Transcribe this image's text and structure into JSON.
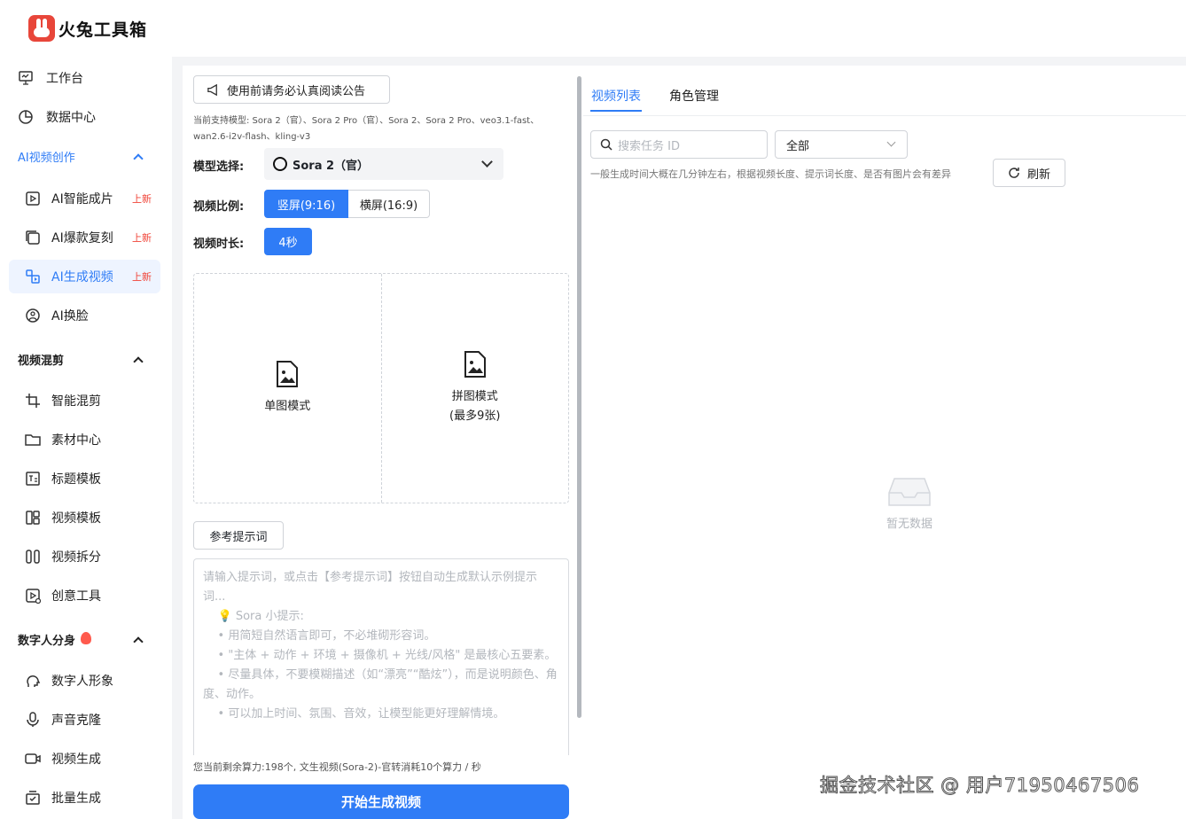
{
  "app": {
    "brand": "火兔工具箱"
  },
  "sidebar": {
    "top_items": [
      {
        "label": "工作台",
        "icon": "monitor-icon"
      },
      {
        "label": "数据中心",
        "icon": "pie-chart-icon"
      }
    ],
    "sections": [
      {
        "label": "AI视频创作",
        "items": [
          {
            "label": "AI智能成片",
            "badge": "上新",
            "icon": "ai-video-icon"
          },
          {
            "label": "AI爆款复刻",
            "badge": "上新",
            "icon": "copy-video-icon"
          },
          {
            "label": "AI生成视频",
            "badge": "上新",
            "icon": "generate-video-icon",
            "active": true
          },
          {
            "label": "AI换脸",
            "icon": "face-swap-icon"
          }
        ]
      },
      {
        "label": "视频混剪",
        "items": [
          {
            "label": "智能混剪",
            "icon": "crop-icon"
          },
          {
            "label": "素材中心",
            "icon": "folder-icon"
          },
          {
            "label": "标题模板",
            "icon": "title-template-icon"
          },
          {
            "label": "视频模板",
            "icon": "layout-template-icon"
          },
          {
            "label": "视频拆分",
            "icon": "split-icon"
          },
          {
            "label": "创意工具",
            "icon": "creative-tool-icon"
          }
        ]
      },
      {
        "label": "数字人分身",
        "items": [
          {
            "label": "数字人形象",
            "icon": "digital-human-icon"
          },
          {
            "label": "声音克隆",
            "icon": "microphone-icon"
          },
          {
            "label": "视频生成",
            "icon": "camera-icon"
          },
          {
            "label": "批量生成",
            "icon": "batch-icon"
          }
        ]
      }
    ]
  },
  "main": {
    "notice_button": "使用前请务必认真阅读公告",
    "supported_models": "当前支持模型: Sora 2（官）、Sora 2 Pro（官）、Sora 2、Sora 2 Pro、veo3.1-fast、wan2.6-i2v-flash、kling-v3",
    "model_label": "模型选择:",
    "model_value": "Sora 2（官）",
    "ratio_label": "视频比例:",
    "ratio_options": [
      "竖屏(9:16)",
      "横屏(16:9)"
    ],
    "duration_label": "视频时长:",
    "duration_value": "4秒",
    "upload_single": "单图模式",
    "upload_collage": "拼图模式",
    "upload_collage_sub": "(最多9张)",
    "ref_prompt_button": "参考提示词",
    "prompt_placeholder": "请输入提示词，或点击【参考提示词】按钮自动生成默认示例提示词...\n    💡 Sora 小提示:\n    • 用简短自然语言即可，不必堆砌形容词。\n    • \"主体 + 动作 + 环境 + 摄像机 + 光线/风格\" 是最核心五要素。\n    • 尽量具体，不要模糊描述（如“漂亮”“酷炫”），而是说明颜色、角度、动作。\n    • 可以加上时间、氛围、音效，让模型能更好理解情境。",
    "quota_text": "您当前剩余算力:198个, 文生视频(Sora-2)-官转消耗10个算力 / 秒",
    "start_button": "开始生成视频"
  },
  "right": {
    "tabs": [
      "视频列表",
      "角色管理"
    ],
    "search_placeholder": "搜索任务 ID",
    "filter_value": "全部",
    "hint": "一般生成时间大概在几分钟左右，根据视频长度、提示词长度、是否有图片会有差异",
    "refresh": "刷新",
    "empty_text": "暂无数据"
  },
  "watermark": "掘金技术社区 @ 用户71950467506",
  "colors": {
    "accent": "#2f7cf6",
    "badge": "#f04438",
    "brand": "#e8463a"
  }
}
